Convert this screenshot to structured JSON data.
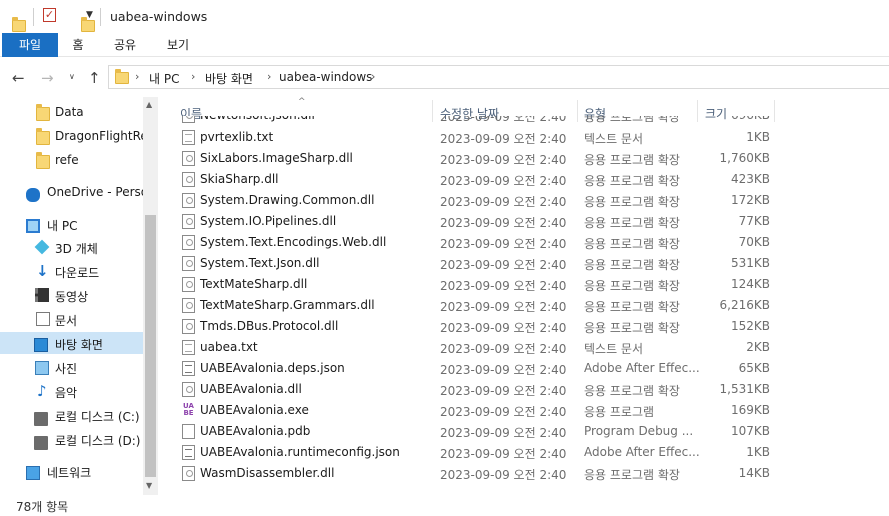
{
  "window": {
    "title": "uabea-windows",
    "colors": {
      "accent": "#1a6fc3",
      "selected_nav": "#cce4f7",
      "folder": "#f8d775"
    }
  },
  "ribbon": {
    "tabs": [
      {
        "label": "파일",
        "active": true
      },
      {
        "label": "홈",
        "active": false
      },
      {
        "label": "공유",
        "active": false
      },
      {
        "label": "보기",
        "active": false
      }
    ]
  },
  "address": {
    "crumbs": [
      "내 PC",
      "바탕 화면",
      "uabea-windows"
    ]
  },
  "nav": {
    "items": [
      {
        "label": "Data",
        "icon": "folder-icon"
      },
      {
        "label": "DragonFlightRes",
        "icon": "folder-icon"
      },
      {
        "label": "refe",
        "icon": "folder-icon"
      },
      {
        "label": "OneDrive - Person",
        "icon": "onedrive-icon"
      },
      {
        "label": "내 PC",
        "icon": "pc-icon"
      },
      {
        "label": "3D 개체",
        "icon": "3d-objects-icon"
      },
      {
        "label": "다운로드",
        "icon": "download-icon"
      },
      {
        "label": "동영상",
        "icon": "video-icon"
      },
      {
        "label": "문서",
        "icon": "document-icon"
      },
      {
        "label": "바탕 화면",
        "icon": "desktop-icon",
        "selected": true
      },
      {
        "label": "사진",
        "icon": "pictures-icon"
      },
      {
        "label": "음악",
        "icon": "music-icon"
      },
      {
        "label": "로컬 디스크 (C:)",
        "icon": "disk-icon"
      },
      {
        "label": "로컬 디스크 (D:)",
        "icon": "disk-icon"
      },
      {
        "label": "네트워크",
        "icon": "network-icon"
      }
    ]
  },
  "columns": {
    "name": "이름",
    "date": "수정한 날짜",
    "type": "유형",
    "size": "크기"
  },
  "files": [
    {
      "name": "Newtonsoft.Json.dll",
      "date": "2023-09-09 오전 2:40",
      "type": "응용 프로그램 확장",
      "size": "696KB",
      "kind": "dll"
    },
    {
      "name": "pvrtexlib.txt",
      "date": "2023-09-09 오전 2:40",
      "type": "텍스트 문서",
      "size": "1KB",
      "kind": "txt"
    },
    {
      "name": "SixLabors.ImageSharp.dll",
      "date": "2023-09-09 오전 2:40",
      "type": "응용 프로그램 확장",
      "size": "1,760KB",
      "kind": "dll"
    },
    {
      "name": "SkiaSharp.dll",
      "date": "2023-09-09 오전 2:40",
      "type": "응용 프로그램 확장",
      "size": "423KB",
      "kind": "dll"
    },
    {
      "name": "System.Drawing.Common.dll",
      "date": "2023-09-09 오전 2:40",
      "type": "응용 프로그램 확장",
      "size": "172KB",
      "kind": "dll"
    },
    {
      "name": "System.IO.Pipelines.dll",
      "date": "2023-09-09 오전 2:40",
      "type": "응용 프로그램 확장",
      "size": "77KB",
      "kind": "dll"
    },
    {
      "name": "System.Text.Encodings.Web.dll",
      "date": "2023-09-09 오전 2:40",
      "type": "응용 프로그램 확장",
      "size": "70KB",
      "kind": "dll"
    },
    {
      "name": "System.Text.Json.dll",
      "date": "2023-09-09 오전 2:40",
      "type": "응용 프로그램 확장",
      "size": "531KB",
      "kind": "dll"
    },
    {
      "name": "TextMateSharp.dll",
      "date": "2023-09-09 오전 2:40",
      "type": "응용 프로그램 확장",
      "size": "124KB",
      "kind": "dll"
    },
    {
      "name": "TextMateSharp.Grammars.dll",
      "date": "2023-09-09 오전 2:40",
      "type": "응용 프로그램 확장",
      "size": "6,216KB",
      "kind": "dll"
    },
    {
      "name": "Tmds.DBus.Protocol.dll",
      "date": "2023-09-09 오전 2:40",
      "type": "응용 프로그램 확장",
      "size": "152KB",
      "kind": "dll"
    },
    {
      "name": "uabea.txt",
      "date": "2023-09-09 오전 2:40",
      "type": "텍스트 문서",
      "size": "2KB",
      "kind": "txt"
    },
    {
      "name": "UABEAvalonia.deps.json",
      "date": "2023-09-09 오전 2:40",
      "type": "Adobe After Effec...",
      "size": "65KB",
      "kind": "json"
    },
    {
      "name": "UABEAvalonia.dll",
      "date": "2023-09-09 오전 2:40",
      "type": "응용 프로그램 확장",
      "size": "1,531KB",
      "kind": "dll"
    },
    {
      "name": "UABEAvalonia.exe",
      "date": "2023-09-09 오전 2:40",
      "type": "응용 프로그램",
      "size": "169KB",
      "kind": "exe"
    },
    {
      "name": "UABEAvalonia.pdb",
      "date": "2023-09-09 오전 2:40",
      "type": "Program Debug ...",
      "size": "107KB",
      "kind": "pdb"
    },
    {
      "name": "UABEAvalonia.runtimeconfig.json",
      "date": "2023-09-09 오전 2:40",
      "type": "Adobe After Effec...",
      "size": "1KB",
      "kind": "json"
    },
    {
      "name": "WasmDisassembler.dll",
      "date": "2023-09-09 오전 2:40",
      "type": "응용 프로그램 확장",
      "size": "14KB",
      "kind": "dll"
    }
  ],
  "status": {
    "item_count": "78개 항목"
  }
}
